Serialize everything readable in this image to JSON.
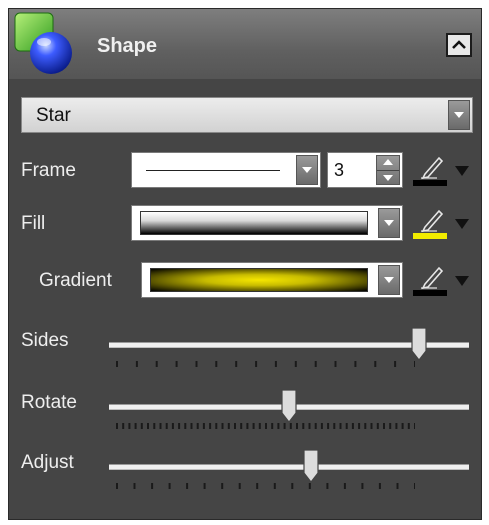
{
  "panel": {
    "title": "Shape",
    "collapse_icon": "chevron-up-icon",
    "logo_icon": "shape-logo-icon"
  },
  "shape_type": {
    "selected": "Star"
  },
  "frame": {
    "label": "Frame",
    "line_style": "solid-thin-line",
    "width_value": "3",
    "color": "#000000"
  },
  "fill": {
    "label": "Fill",
    "gradient_colors": [
      "#ffffff",
      "#000000"
    ],
    "color": "#f2ec00"
  },
  "gradient": {
    "label": "Gradient",
    "gradient_colors": [
      "#f5e600",
      "#000000"
    ],
    "color": "#000000"
  },
  "sliders": [
    {
      "label": "Sides",
      "value": 0.86,
      "ticks": 16
    },
    {
      "label": "Rotate",
      "value": 0.5,
      "ticks": 49
    },
    {
      "label": "Adjust",
      "value": 0.56,
      "ticks": 18
    }
  ],
  "colors": {
    "panel_background": "#454545",
    "header_gradient_top": "#7e7e7e",
    "label_text": "#eeeeee"
  }
}
